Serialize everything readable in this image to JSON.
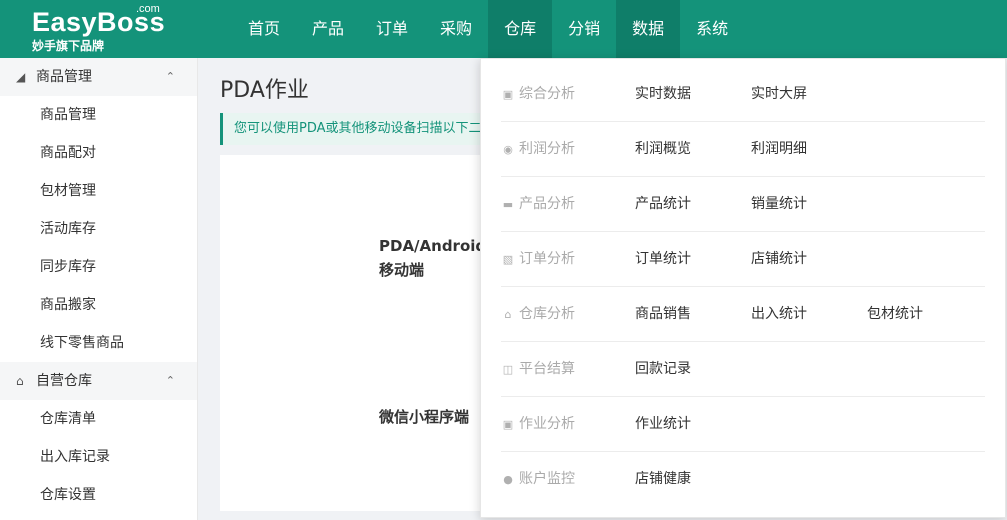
{
  "logo": {
    "main": "EasyBoss",
    "com": ".com",
    "sub": "妙手旗下品牌"
  },
  "nav": [
    "首页",
    "产品",
    "订单",
    "采购",
    "仓库",
    "分销",
    "数据",
    "系统"
  ],
  "sidebar": {
    "groups": [
      {
        "title": "商品管理",
        "icon": "tag-icon",
        "items": [
          "商品管理",
          "商品配对",
          "包材管理",
          "活动库存",
          "同步库存",
          "商品搬家",
          "线下零售商品"
        ]
      },
      {
        "title": "自营仓库",
        "icon": "warehouse-icon",
        "items": [
          "仓库清单",
          "出入库记录",
          "仓库设置"
        ]
      }
    ]
  },
  "main": {
    "title": "PDA作业",
    "notice": "您可以使用PDA或其他移动设备扫描以下二",
    "option1": "PDA/Android",
    "option1_sub": "移动端",
    "option2": "微信小程序端"
  },
  "dropdown": [
    {
      "category": "综合分析",
      "icon": "briefcase-icon",
      "items": [
        "实时数据",
        "实时大屏"
      ]
    },
    {
      "category": "利润分析",
      "icon": "coin-icon",
      "items": [
        "利润概览",
        "利润明细"
      ]
    },
    {
      "category": "产品分析",
      "icon": "card-icon",
      "items": [
        "产品统计",
        "销量统计"
      ]
    },
    {
      "category": "订单分析",
      "icon": "bar-chart-icon",
      "items": [
        "订单统计",
        "店铺统计"
      ]
    },
    {
      "category": "仓库分析",
      "icon": "warehouse-icon",
      "items": [
        "商品销售",
        "出入统计",
        "包材统计"
      ]
    },
    {
      "category": "平台结算",
      "icon": "database-icon",
      "items": [
        "回款记录"
      ]
    },
    {
      "category": "作业分析",
      "icon": "briefcase-icon",
      "items": [
        "作业统计"
      ]
    },
    {
      "category": "账户监控",
      "icon": "user-icon",
      "items": [
        "店铺健康"
      ]
    }
  ],
  "colors": {
    "brand": "#14937a",
    "nav_active": "#0f7e69"
  }
}
